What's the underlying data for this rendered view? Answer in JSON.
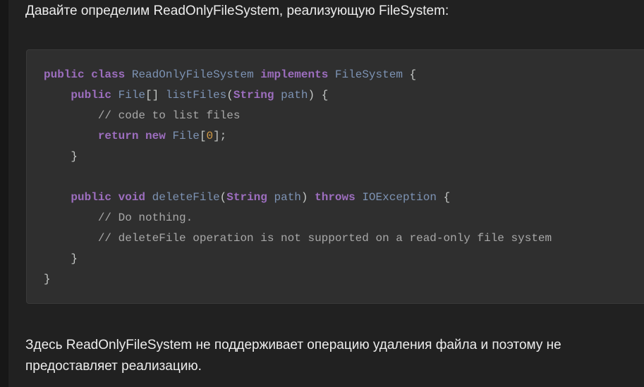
{
  "intro_text": "Давайте определим ReadOnlyFileSystem, реализующую FileSystem:",
  "code": {
    "language": "java",
    "l1": {
      "kw1": "public",
      "kw2": "class",
      "cls": "ReadOnlyFileSystem",
      "kw3": "implements",
      "iface": "FileSystem",
      "brace": "{"
    },
    "l2": {
      "kw1": "public",
      "type": "File",
      "arr": "[]",
      "fn": "listFiles",
      "lp": "(",
      "ptype": "String",
      "pname": "path",
      "rp": ")",
      "brace": "{"
    },
    "l3": {
      "comment": "// code to list files"
    },
    "l4": {
      "kw1": "return",
      "kw2": "new",
      "type": "File",
      "lb": "[",
      "num": "0",
      "rb": "];"
    },
    "l5": {
      "brace": "}"
    },
    "l7": {
      "kw1": "public",
      "kw2": "void",
      "fn": "deleteFile",
      "lp": "(",
      "ptype": "String",
      "pname": "path",
      "rp": ")",
      "kw3": "throws",
      "exc": "IOException",
      "brace": "{"
    },
    "l8": {
      "comment": "// Do nothing."
    },
    "l9": {
      "comment": "// deleteFile operation is not supported on a read-only file system"
    },
    "l10": {
      "brace": "}"
    },
    "l11": {
      "brace": "}"
    }
  },
  "outro_text": "Здесь ReadOnlyFileSystem не поддерживает операцию удаления файла и поэтому не предоставляет реализацию.",
  "colors": {
    "background": "#212121",
    "code_background": "#2f2f2f",
    "keyword": "#9d6ebf",
    "type": "#7d93b4",
    "comment": "#a8a8a8",
    "number": "#d29b46",
    "text": "#ececec"
  }
}
